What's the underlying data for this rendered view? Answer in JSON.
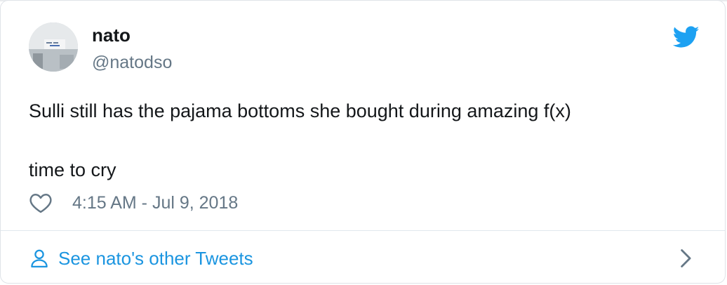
{
  "tweet": {
    "author": {
      "display_name": "nato",
      "handle": "@natodso",
      "avatar_icon": "avatar-photo"
    },
    "text_lines": [
      "Sulli still has the pajama bottoms she bought during amazing f(x)",
      "time to cry"
    ],
    "timestamp": "4:15 AM - Jul 9, 2018",
    "like_icon": "heart-icon",
    "brand_icon": "twitter-bird-icon"
  },
  "footer": {
    "link_label": "See nato's other Tweets",
    "link_icon": "person-icon",
    "chevron_icon": "chevron-right-icon"
  },
  "colors": {
    "brand_blue": "#1DA1F2",
    "link_blue": "#1B95E0",
    "secondary_text": "#657786",
    "primary_text": "#14171A"
  }
}
